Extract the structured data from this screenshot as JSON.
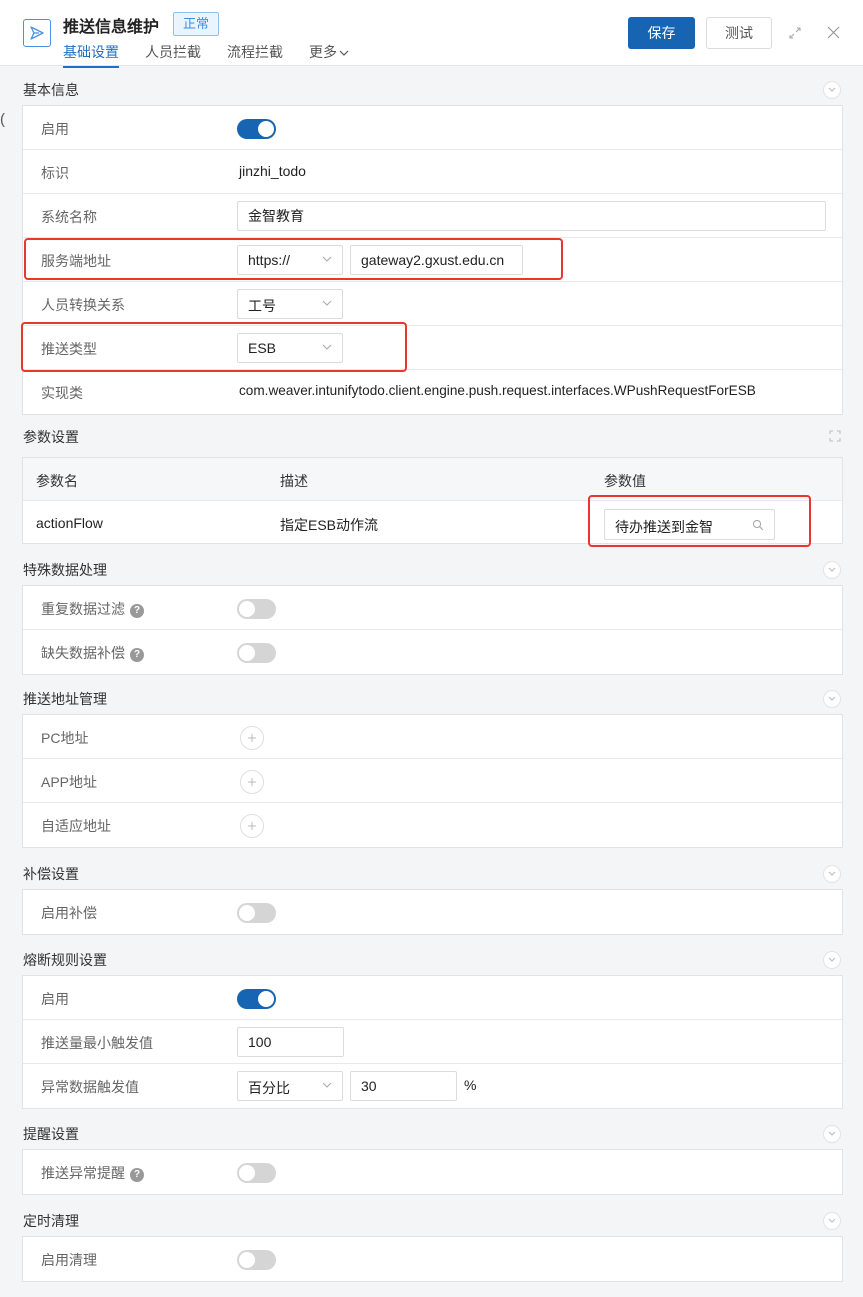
{
  "header": {
    "title": "推送信息维护",
    "status": "正常",
    "tabs": [
      "基础设置",
      "人员拦截",
      "流程拦截",
      "更多"
    ],
    "save_label": "保存",
    "test_label": "测试"
  },
  "left_glyph": "(",
  "basic_info": {
    "title": "基本信息",
    "enable_label": "启用",
    "id_label": "标识",
    "id_value": "jinzhi_todo",
    "system_name_label": "系统名称",
    "system_name_value": "金智教育",
    "server_addr_label": "服务端地址",
    "protocol_value": "https://",
    "host_value": "gateway2.gxust.edu.cn",
    "user_mapping_label": "人员转换关系",
    "user_mapping_value": "工号",
    "push_type_label": "推送类型",
    "push_type_value": "ESB",
    "impl_label": "实现类",
    "impl_value": "com.weaver.intunifytodo.client.engine.push.request.interfaces.WPushRequestForESB"
  },
  "params": {
    "title": "参数设置",
    "col_name": "参数名",
    "col_desc": "描述",
    "col_value": "参数值",
    "row_name": "actionFlow",
    "row_desc": "指定ESB动作流",
    "row_value": "待办推送到金智"
  },
  "special": {
    "title": "特殊数据处理",
    "dup_label": "重复数据过滤",
    "missing_label": "缺失数据补偿",
    "help_glyph": "?"
  },
  "push_addr": {
    "title": "推送地址管理",
    "pc_label": "PC地址",
    "app_label": "APP地址",
    "adaptive_label": "自适应地址"
  },
  "compensation": {
    "title": "补偿设置",
    "enable_label": "启用补偿"
  },
  "circuit": {
    "title": "熔断规则设置",
    "enable_label": "启用",
    "min_trigger_label": "推送量最小触发值",
    "min_trigger_value": "100",
    "abnormal_label": "异常数据触发值",
    "abnormal_type": "百分比",
    "abnormal_value": "30",
    "percent_sign": "%"
  },
  "reminder": {
    "title": "提醒设置",
    "label": "推送异常提醒"
  },
  "cleanup": {
    "title": "定时清理",
    "label": "启用清理"
  },
  "colors": {
    "primary": "#1764b3",
    "highlight": "#e8382d",
    "badge": "#3b8ee0"
  }
}
